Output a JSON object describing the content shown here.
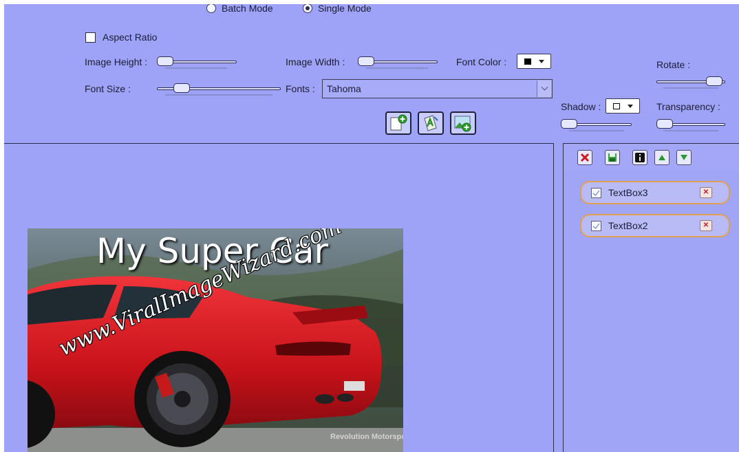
{
  "mode": {
    "batch_label": "Batch Mode",
    "single_label": "Single Mode",
    "selected": "Single Mode"
  },
  "aspect_ratio": {
    "label": "Aspect Ratio",
    "checked": false
  },
  "image_height": {
    "label": "Image Height :",
    "value": 0.05
  },
  "image_width": {
    "label": "Image Width :",
    "value": 0.05
  },
  "font_color": {
    "label": "Font Color :",
    "swatch": "#000000"
  },
  "font_size": {
    "label": "Font Size :",
    "value": 0.15
  },
  "fonts": {
    "label": "Fonts :",
    "selected": "Tahoma"
  },
  "rotate": {
    "label": "Rotate :",
    "value": 1.0
  },
  "shadow": {
    "label": "Shadow :",
    "swatch": "#ffffff"
  },
  "transparency": {
    "label": "Transparency :",
    "value": 0.05
  },
  "toolbar": [
    {
      "name": "add-text-icon"
    },
    {
      "name": "font-style-icon"
    },
    {
      "name": "add-image-icon"
    }
  ],
  "layers_toolbar": [
    {
      "name": "delete-icon"
    },
    {
      "name": "save-icon"
    },
    {
      "name": "info-icon"
    },
    {
      "name": "move-up-icon"
    },
    {
      "name": "move-down-icon"
    }
  ],
  "layers": [
    {
      "name": "TextBox3",
      "checked": true
    },
    {
      "name": "TextBox2",
      "checked": true
    }
  ],
  "canvas": {
    "title_text": "My Super Car",
    "watermark_text": "www.ViralImageWizard.com",
    "photo_credit": "Revolution Motorsports"
  },
  "colors": {
    "background": "#9ea3f7",
    "layer_border": "#e0a050",
    "car_red": "#d4141c"
  }
}
